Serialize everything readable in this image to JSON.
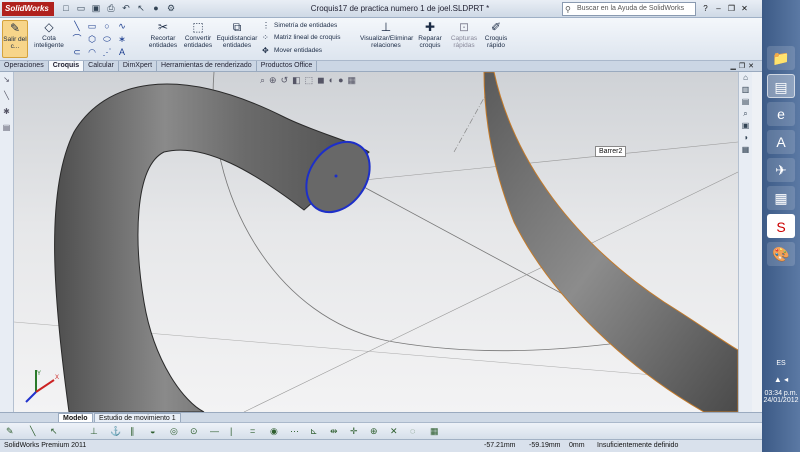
{
  "app": {
    "logo": "SolidWorks",
    "window_title": "Croquis17 de practica numero 1 de joel.SLDPRT *",
    "search_placeholder": "Buscar en la Ayuda de SolidWorks"
  },
  "ribbon": {
    "exit_sketch": "Salir del c...",
    "smart_dim": "Cota inteligente",
    "trim": "Recortar entidades",
    "convert": "Convertir entidades",
    "offset": "Equidistanciar entidades",
    "mirror": "Simetría de entidades",
    "linear_pattern": "Matriz lineal de croquis",
    "move": "Mover entidades",
    "display_delete": "Visualizar/Eliminar relaciones",
    "repair": "Reparar croquis",
    "quick_snaps": "Capturas rápidas",
    "rapid_sketch": "Croquis rápido"
  },
  "tabs": [
    "Operaciones",
    "Croquis",
    "Calcular",
    "DimXpert",
    "Herramientas de renderizado",
    "Productos Office"
  ],
  "active_tab": "Croquis",
  "viewport": {
    "feature_label": "Barrer2",
    "triad_x": "X",
    "triad_y": "Y"
  },
  "model_tabs": [
    "Modelo",
    "Estudio de movimiento 1"
  ],
  "status": {
    "product": "SolidWorks Premium 2011",
    "x": "-57.21mm",
    "y": "-59.19mm",
    "z": "0mm",
    "state": "Insuficientemente definido"
  },
  "taskbar": {
    "lang": "ES",
    "time": "03:34 p.m.",
    "date": "24/01/2012"
  },
  "colors": {
    "accent": "#f7d58a",
    "circle": "#1d2fc9",
    "tube": "#6f6f6f"
  }
}
